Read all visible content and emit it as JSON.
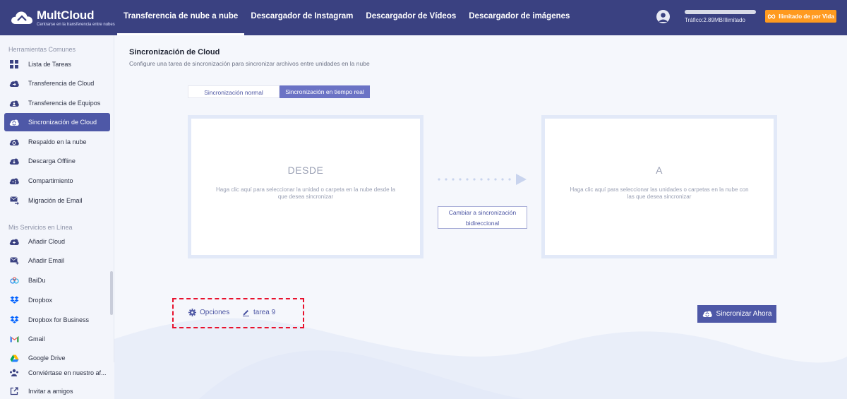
{
  "header": {
    "brand": "MultCloud",
    "tagline": "Centrarse en la transferencia entre nubes",
    "nav": [
      {
        "label": "Transferencia de nube a nube",
        "active": true
      },
      {
        "label": "Descargador de Instagram",
        "active": false
      },
      {
        "label": "Descargador de Vídeos",
        "active": false
      },
      {
        "label": "Descargador de imágenes",
        "active": false
      }
    ],
    "traffic": "Tráfico:2.89MB/Ilimitado",
    "plan_label": "Ilimitado de por Vida",
    "accent_color": "#ff9a1f",
    "bar_color": "#3a4181"
  },
  "sidebar": {
    "section1_title": "Herramientas Comunes",
    "section1": [
      {
        "label": "Lista de Tareas",
        "icon": "grid-icon"
      },
      {
        "label": "Transferencia de Cloud",
        "icon": "cloud-transfer-icon"
      },
      {
        "label": "Transferencia de Equipos",
        "icon": "cloud-team-icon"
      },
      {
        "label": "Sincronización de Cloud",
        "icon": "cloud-sync-icon",
        "active": true
      },
      {
        "label": "Respaldo en la nube",
        "icon": "cloud-backup-icon"
      },
      {
        "label": "Descarga Offline",
        "icon": "cloud-download-icon"
      },
      {
        "label": "Compartimiento",
        "icon": "cloud-share-icon"
      },
      {
        "label": "Migración de Email",
        "icon": "email-migration-icon"
      }
    ],
    "section2_title": "Mis Servicios en Línea",
    "section2": [
      {
        "label": "Añadir Cloud",
        "icon": "add-cloud-icon"
      },
      {
        "label": "Añadir Email",
        "icon": "add-email-icon"
      },
      {
        "label": "BaiDu",
        "icon": "baidu-icon"
      },
      {
        "label": "Dropbox",
        "icon": "dropbox-icon"
      },
      {
        "label": "Dropbox for Business",
        "icon": "dropbox-business-icon"
      },
      {
        "label": "Gmail",
        "icon": "gmail-icon"
      },
      {
        "label": "Google Drive",
        "icon": "google-drive-icon"
      }
    ],
    "footer": [
      {
        "label": "Conviértase en nuestro af...",
        "icon": "affiliate-icon"
      },
      {
        "label": "Invitar a amigos",
        "icon": "invite-icon"
      }
    ]
  },
  "main": {
    "title": "Sincronización de Cloud",
    "subtitle": "Configure una tarea de sincronización para sincronizar archivos entre unidades en la nube",
    "tabs": [
      {
        "label": "Sincronización normal",
        "active": false
      },
      {
        "label": "Sincronización en tiempo real",
        "active": true
      }
    ],
    "from": {
      "title": "DESDE",
      "desc": "Haga clic aquí para seleccionar la unidad o carpeta en la nube desde la que desea sincronizar"
    },
    "to": {
      "title": "A",
      "desc": "Haga clic aquí para seleccionar las unidades o carpetas en la nube con las que desea sincronizar"
    },
    "bidirectional_label_1": "Cambiar a sincronización",
    "bidirectional_label_2": "bidireccional",
    "options_label": "Opciones",
    "task_name": "tarea 9",
    "sync_now_label": "Sincronizar Ahora",
    "highlight_color": "#e8112d"
  }
}
